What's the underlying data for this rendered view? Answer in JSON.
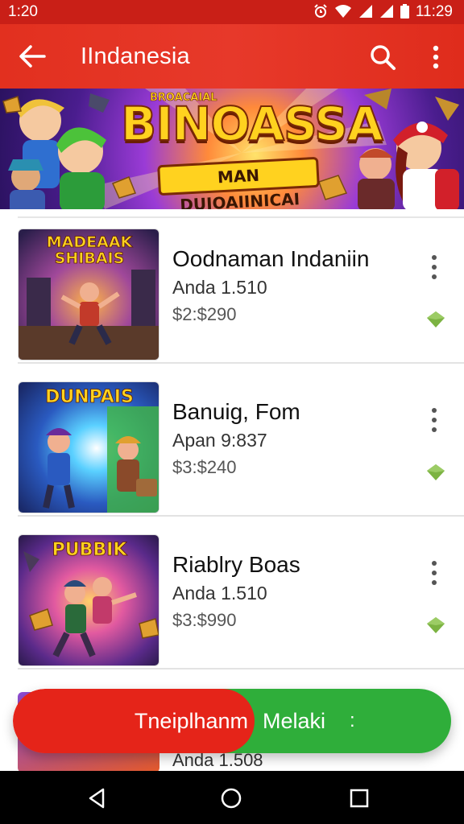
{
  "status_bar": {
    "time_left": "1:20",
    "time_right": "11:29",
    "icons": [
      "alarm-icon",
      "wifi-icon",
      "signal-icon",
      "signal-icon",
      "battery-icon"
    ]
  },
  "app_bar": {
    "title": "IIndanesia",
    "back_icon": "arrow-left-icon",
    "search_icon": "search-icon",
    "more_icon": "more-vertical-icon"
  },
  "banner": {
    "top_text": "BROACAIAL",
    "title": "BINOASSA",
    "subtitle": "MAN DUIOAIINICAI"
  },
  "games": [
    {
      "name": "Oodnaman Indaniin",
      "rating": "Anda 1.510",
      "price": "$2:$290",
      "thumb_title": "MADEAAK SHIBAIS",
      "thumb_colors": [
        "#3a2a6a",
        "#e08a2a"
      ]
    },
    {
      "name": "Banuig, Fom",
      "rating": "Apan 9:837",
      "price": "$3:$240",
      "thumb_title": "DUNPAIS",
      "thumb_colors": [
        "#1f4fa8",
        "#3fb24a"
      ]
    },
    {
      "name": "Riablry Boas",
      "rating": "Anda 1.510",
      "price": "$3:$990",
      "thumb_title": "PUBBIK",
      "thumb_colors": [
        "#7a2a8a",
        "#f08a2a"
      ]
    }
  ],
  "partial_item": {
    "rating": "Anda 1.508"
  },
  "action_bar": {
    "left_label": "Tneiplhanm",
    "right_label": "Melaki",
    "right_suffix": ":",
    "left_color": "#e52419",
    "right_color": "#2fae3a"
  },
  "nav_bar": {
    "back_icon": "triangle-back-icon",
    "home_icon": "circle-home-icon",
    "recents_icon": "square-recents-icon"
  },
  "colors": {
    "primary": "#e2301f",
    "accent_badge": "#7cb342"
  }
}
